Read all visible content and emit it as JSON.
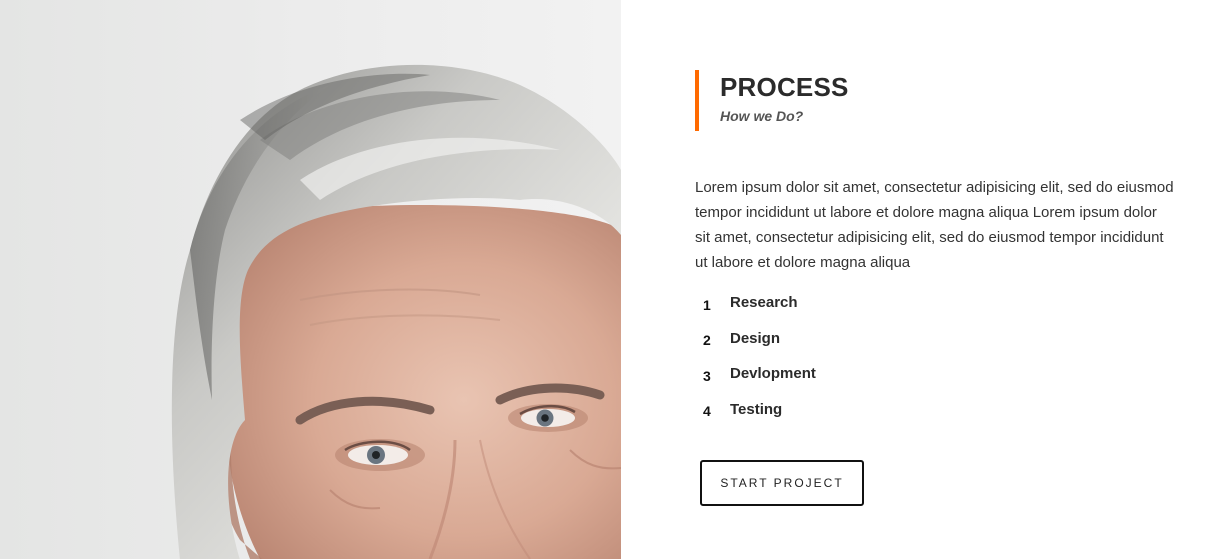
{
  "hero_image": {
    "icon": "portrait-photo"
  },
  "process": {
    "title": "PROCESS",
    "subtitle": "How we Do?",
    "accent_color": "#ff6a00",
    "description": "Lorem ipsum dolor sit amet, consectetur adipisicing elit, sed do eiusmod tempor incididunt ut labore et dolore magna aliqua Lorem ipsum dolor sit amet, consectetur adipisicing elit, sed do eiusmod tempor incididunt ut labore et dolore magna aliqua",
    "steps": [
      {
        "number": "1",
        "label": "Research"
      },
      {
        "number": "2",
        "label": "Design"
      },
      {
        "number": "3",
        "label": "Devlopment"
      },
      {
        "number": "4",
        "label": "Testing"
      }
    ],
    "button_label": "START PROJECT"
  }
}
